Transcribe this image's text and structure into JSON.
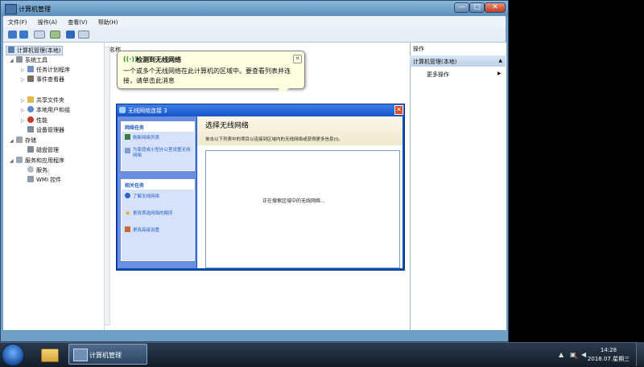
{
  "window": {
    "title": "计算机管理",
    "menu": [
      "文件(F)",
      "操作(A)",
      "查看(V)",
      "帮助(H)"
    ],
    "controls": {
      "minimize": "—",
      "maximize": "▢",
      "close": "✕"
    }
  },
  "tree": {
    "root": "计算机管理(本地)",
    "system_tools": "系统工具",
    "items": [
      "任务计划程序",
      "事件查看器",
      "共享文件夹",
      "本地用户和组",
      "性能",
      "设备管理器"
    ],
    "storage": "存储",
    "disk_mgmt": "磁盘管理",
    "services_apps": "服务和应用程序",
    "services": "服务",
    "wmi": "WMI 控件"
  },
  "middle": {
    "column_name": "名称"
  },
  "actions": {
    "header": "操作",
    "bar": "计算机管理(本地)",
    "more": "更多操作"
  },
  "balloon": {
    "title": "检测到无线网络",
    "body": "一个或多个无线网络在此计算机的区域中。要查看列表并连接，请单击此消息",
    "close": "✕"
  },
  "wireless_dialog": {
    "title": "无线网络连接 3",
    "close": "✕",
    "network_tasks": {
      "head": "网络任务",
      "links": [
        "刷新网络列表",
        "为家庭或小型办公室设置无线网络"
      ]
    },
    "related_tasks": {
      "head": "相关任务",
      "links": [
        "了解无线网络",
        "更改首选网络的顺序",
        "更改高级设置"
      ]
    },
    "heading": "选择无线网络",
    "subtitle": "单击以下列表中的项目以连接到区域内的无线网络或获得更多信息(I)。",
    "searching": "正在搜索区域中的无线网络..."
  },
  "taskbar": {
    "app_label": "计算机管理",
    "time": "14:28",
    "date": "2018.07.星期三"
  }
}
